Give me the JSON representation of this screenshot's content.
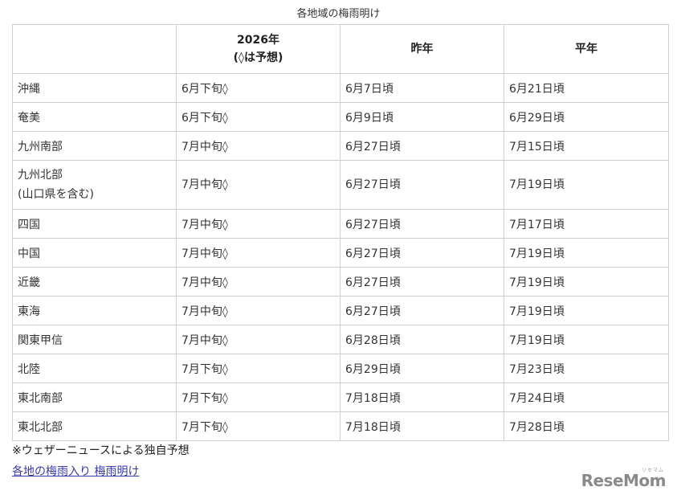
{
  "caption": "各地域の梅雨明け",
  "table": {
    "headers": [
      "",
      "2026年",
      "(◊は予想)",
      "昨年",
      "平年"
    ],
    "rows": [
      {
        "region": "沖縄",
        "y2026": "6月下旬◊",
        "last": "6月7日頃",
        "normal": "6月21日頃"
      },
      {
        "region": "奄美",
        "y2026": "6月下旬◊",
        "last": "6月9日頃",
        "normal": "6月29日頃"
      },
      {
        "region": "九州南部",
        "y2026": "7月中旬◊",
        "last": "6月27日頃",
        "normal": "7月15日頃"
      },
      {
        "region": "九州北部",
        "region_sub": "(山口県を含む)",
        "y2026": "7月中旬◊",
        "last": "6月27日頃",
        "normal": "7月19日頃"
      },
      {
        "region": "四国",
        "y2026": "7月中旬◊",
        "last": "6月27日頃",
        "normal": "7月17日頃"
      },
      {
        "region": "中国",
        "y2026": "7月中旬◊",
        "last": "6月27日頃",
        "normal": "7月19日頃"
      },
      {
        "region": "近畿",
        "y2026": "7月中旬◊",
        "last": "6月27日頃",
        "normal": "7月19日頃"
      },
      {
        "region": "東海",
        "y2026": "7月中旬◊",
        "last": "6月27日頃",
        "normal": "7月19日頃"
      },
      {
        "region": "関東甲信",
        "y2026": "7月中旬◊",
        "last": "6月28日頃",
        "normal": "7月19日頃"
      },
      {
        "region": "北陸",
        "y2026": "7月下旬◊",
        "last": "6月29日頃",
        "normal": "7月23日頃"
      },
      {
        "region": "東北南部",
        "y2026": "7月下旬◊",
        "last": "7月18日頃",
        "normal": "7月24日頃"
      },
      {
        "region": "東北北部",
        "y2026": "7月下旬◊",
        "last": "7月18日頃",
        "normal": "7月28日頃"
      }
    ]
  },
  "note": "※ウェザーニュースによる独自予想",
  "link": "各地の梅雨入り 梅雨明け",
  "logo": {
    "text": "ReseMom",
    "sub": "リセマム"
  }
}
